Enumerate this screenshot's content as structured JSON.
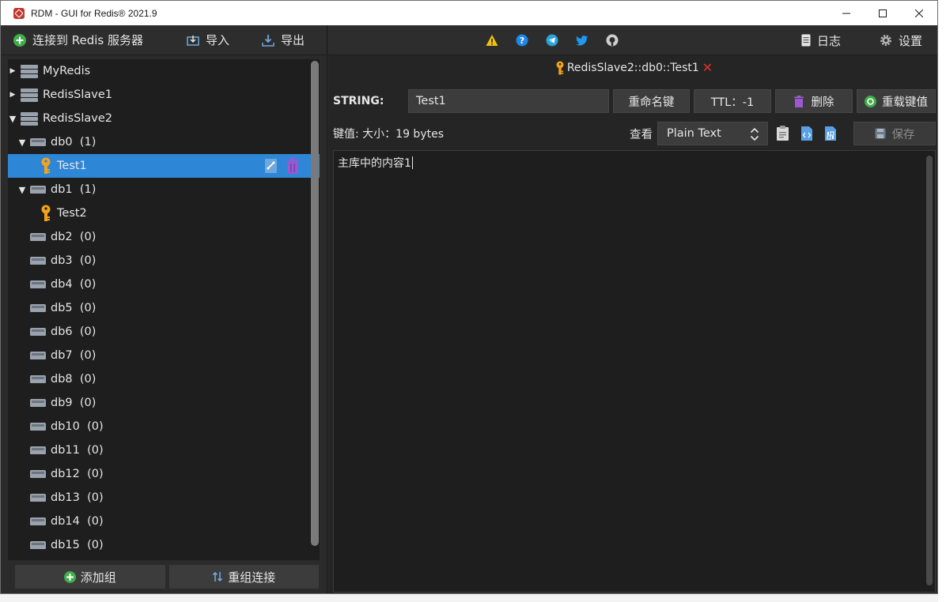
{
  "window": {
    "title": "RDM - GUI for Redis® 2021.9"
  },
  "left_toolbar": {
    "connect_label": "连接到 Redis 服务器",
    "import_label": "导入",
    "export_label": "导出"
  },
  "tree": {
    "servers": [
      {
        "name": "MyRedis"
      },
      {
        "name": "RedisSlave1"
      },
      {
        "name": "RedisSlave2"
      }
    ],
    "dbs": [
      {
        "name": "db0",
        "count": "(1)"
      },
      {
        "name": "db1",
        "count": "(1)"
      },
      {
        "name": "db2",
        "count": "(0)"
      },
      {
        "name": "db3",
        "count": "(0)"
      },
      {
        "name": "db4",
        "count": "(0)"
      },
      {
        "name": "db5",
        "count": "(0)"
      },
      {
        "name": "db6",
        "count": "(0)"
      },
      {
        "name": "db7",
        "count": "(0)"
      },
      {
        "name": "db8",
        "count": "(0)"
      },
      {
        "name": "db9",
        "count": "(0)"
      },
      {
        "name": "db10",
        "count": "(0)"
      },
      {
        "name": "db11",
        "count": "(0)"
      },
      {
        "name": "db12",
        "count": "(0)"
      },
      {
        "name": "db13",
        "count": "(0)"
      },
      {
        "name": "db14",
        "count": "(0)"
      },
      {
        "name": "db15",
        "count": "(0)"
      }
    ],
    "keys": [
      {
        "name": "Test1"
      },
      {
        "name": "Test2"
      }
    ]
  },
  "left_bottom": {
    "add_group_label": "添加组",
    "regroup_label": "重组连接"
  },
  "right_toolbar": {
    "log_label": "日志",
    "settings_label": "设置"
  },
  "tab": {
    "title": "RedisSlave2::db0::Test1",
    "close_glyph": "✕"
  },
  "key": {
    "type_label": "STRING:",
    "name": "Test1",
    "rename_label": "重命名键",
    "ttl_label": "TTL：-1",
    "delete_label": "删除",
    "reload_label": "重载键值"
  },
  "value": {
    "label": "键值: 大小：19 bytes",
    "view_label": "查看",
    "format": "Plain Text",
    "save_label": "保存",
    "content": "主库中的内容1"
  },
  "colors": {
    "selection": "#2e86d6",
    "key_icon": "#f4a21b",
    "connect_icon": "#3fae49",
    "delete_icon": "#9b59d0",
    "close": "#e0352b"
  }
}
